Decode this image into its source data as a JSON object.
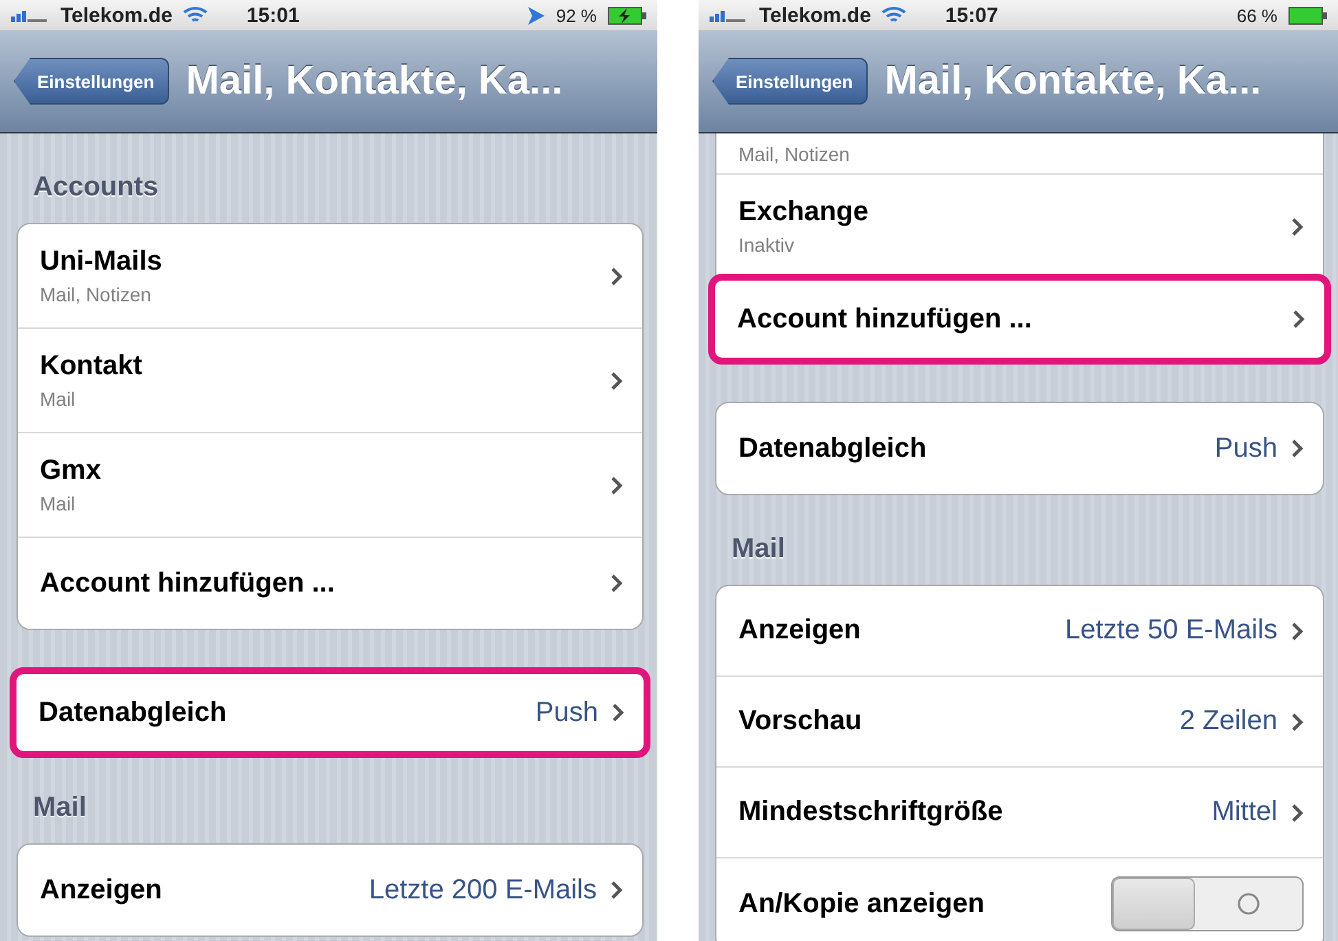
{
  "phones": [
    {
      "status": {
        "carrier": "Telekom.de",
        "time": "15:01",
        "battery": "92 %",
        "location": true,
        "charging": true
      },
      "nav": {
        "back": "Einstellungen",
        "title": "Mail, Kontakte, Ka..."
      },
      "sections": [
        {
          "header": "Accounts",
          "rows": [
            {
              "kind": "link",
              "title": "Uni-Mails",
              "subtitle": "Mail, Notizen",
              "highlighted": false
            },
            {
              "kind": "link",
              "title": "Kontakt",
              "subtitle": "Mail",
              "highlighted": false
            },
            {
              "kind": "link",
              "title": "Gmx",
              "subtitle": "Mail",
              "highlighted": false
            },
            {
              "kind": "link",
              "title": "Account hinzufügen ...",
              "highlighted": false
            }
          ]
        },
        {
          "rows": [
            {
              "kind": "link",
              "title": "Datenabgleich",
              "value": "Push",
              "highlighted": true
            }
          ]
        },
        {
          "header": "Mail",
          "rows": [
            {
              "kind": "link",
              "title": "Anzeigen",
              "value": "Letzte 200 E-Mails",
              "highlighted": false
            }
          ]
        }
      ]
    },
    {
      "status": {
        "carrier": "Telekom.de",
        "time": "15:07",
        "battery": "66 %",
        "location": false,
        "charging": false
      },
      "nav": {
        "back": "Einstellungen",
        "title": "Mail, Kontakte, Ka..."
      },
      "sections": [
        {
          "rows": [
            {
              "kind": "partial",
              "subtitle": "Mail, Notizen",
              "highlighted": false
            },
            {
              "kind": "link",
              "title": "Exchange",
              "subtitle": "Inaktiv",
              "highlighted": false
            },
            {
              "kind": "link",
              "title": "Account hinzufügen ...",
              "highlighted": true
            }
          ]
        },
        {
          "rows": [
            {
              "kind": "link",
              "title": "Datenabgleich",
              "value": "Push",
              "highlighted": false
            }
          ]
        },
        {
          "header": "Mail",
          "rows": [
            {
              "kind": "link",
              "title": "Anzeigen",
              "value": "Letzte 50 E-Mails",
              "highlighted": false
            },
            {
              "kind": "link",
              "title": "Vorschau",
              "value": "2 Zeilen",
              "highlighted": false
            },
            {
              "kind": "link",
              "title": "Mindestschriftgröße",
              "value": "Mittel",
              "highlighted": false
            },
            {
              "kind": "toggle",
              "title": "An/Kopie anzeigen",
              "on": false,
              "highlighted": false
            }
          ]
        }
      ]
    }
  ]
}
